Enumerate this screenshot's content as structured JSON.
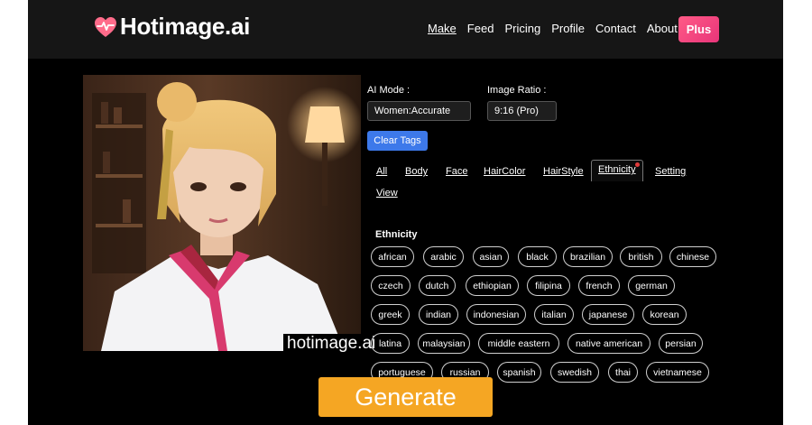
{
  "header": {
    "brand": "Hotimage.ai",
    "nav": [
      "Make",
      "Feed",
      "Pricing",
      "Profile",
      "Contact",
      "About"
    ],
    "active_nav": "Make",
    "plus_label": "Plus"
  },
  "image": {
    "watermark": "hotimage.ai"
  },
  "controls": {
    "ai_mode_label": "AI Mode :",
    "ai_mode_value": "Women:Accurate",
    "ratio_label": "Image Ratio :",
    "ratio_value": "9:16 (Pro)",
    "clear_label": "Clear Tags"
  },
  "tabs": [
    "All",
    "Body",
    "Face",
    "HairColor",
    "HairStyle",
    "Ethnicity",
    "Setting",
    "View"
  ],
  "selected_tab": "Ethnicity",
  "ethnicity": {
    "title": "Ethnicity",
    "rows": [
      [
        "african",
        "arabic",
        "asian",
        "black",
        "brazilian",
        "british",
        "chinese"
      ],
      [
        "czech",
        "dutch",
        "ethiopian",
        "filipina",
        "french",
        "german"
      ],
      [
        "greek",
        "indian",
        "indonesian",
        "italian",
        "japanese",
        "korean"
      ],
      [
        "latina",
        "malaysian",
        "middle eastern",
        "native american",
        "persian"
      ],
      [
        "portuguese",
        "russian",
        "spanish",
        "swedish",
        "thai",
        "vietnamese"
      ]
    ]
  },
  "generate_label": "Generate",
  "colors": {
    "background": "#000000",
    "topbar": "#161616",
    "brand_heart": "#ff6b8a",
    "plus_button": "#e8357a",
    "clear_button": "#3d79ea",
    "generate_button": "#f5a623",
    "tab_dot": "#e23b3b"
  },
  "icons": {
    "logo": "heart-pulse-icon"
  }
}
